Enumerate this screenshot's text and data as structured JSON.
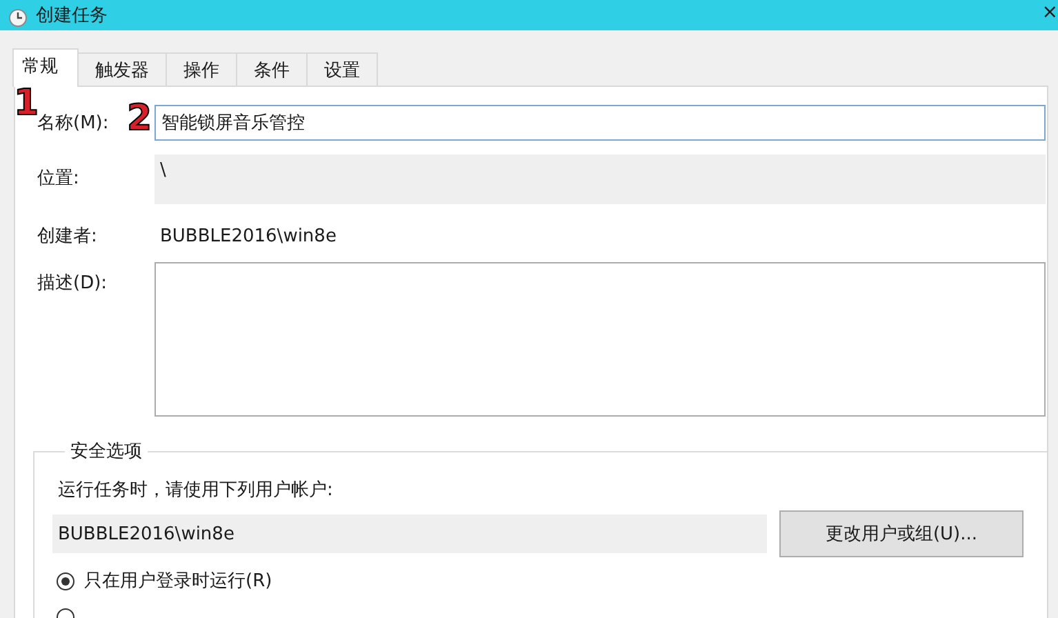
{
  "window": {
    "title": "创建任务",
    "close": "×"
  },
  "tabs": [
    {
      "label": "常规",
      "selected": true
    },
    {
      "label": "触发器",
      "selected": false
    },
    {
      "label": "操作",
      "selected": false
    },
    {
      "label": "条件",
      "selected": false
    },
    {
      "label": "设置",
      "selected": false
    }
  ],
  "annotations": [
    "1",
    "2"
  ],
  "general": {
    "name_label": "名称(M):",
    "name_value": "智能锁屏音乐管控",
    "location_label": "位置:",
    "location_value": "\\",
    "author_label": "创建者:",
    "author_value": "BUBBLE2016\\win8e",
    "description_label": "描述(D):"
  },
  "security": {
    "title": "安全选项",
    "account_prompt": "运行任务时，请使用下列用户帐户:",
    "account": "BUBBLE2016\\win8e",
    "change_button": "更改用户或组(U)...",
    "options": [
      {
        "label": "只在用户登录时运行(R)",
        "selected": true
      },
      {
        "selected": false
      }
    ]
  }
}
